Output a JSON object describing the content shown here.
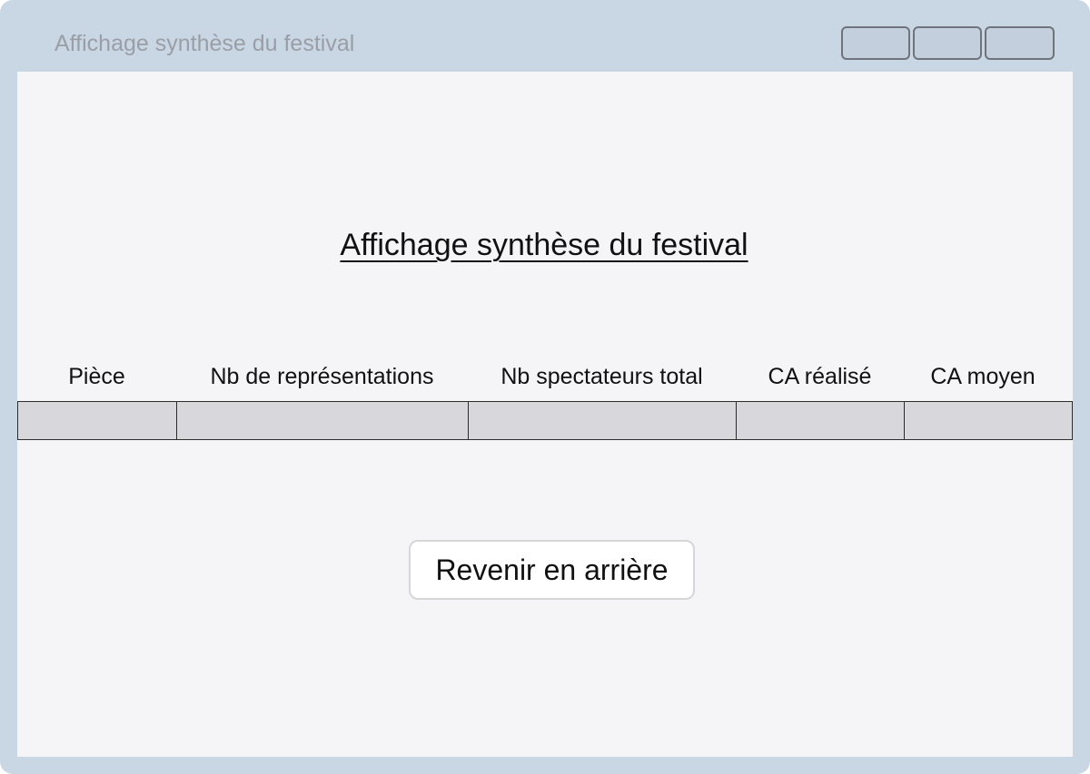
{
  "window": {
    "title": "Affichage synthèse du festival"
  },
  "page": {
    "title": "Affichage synthèse du festival"
  },
  "table": {
    "columns": [
      "Pièce",
      "Nb de représentations",
      "Nb spectateurs total",
      "CA réalisé",
      "CA moyen"
    ],
    "rows": [
      [
        "",
        "",
        "",
        "",
        ""
      ]
    ]
  },
  "actions": {
    "back_label": "Revenir en arrière"
  },
  "colors": {
    "window_frame": "#c9d6e3",
    "content_bg": "#f5f5f7",
    "row_bg": "#d8d8dc"
  }
}
